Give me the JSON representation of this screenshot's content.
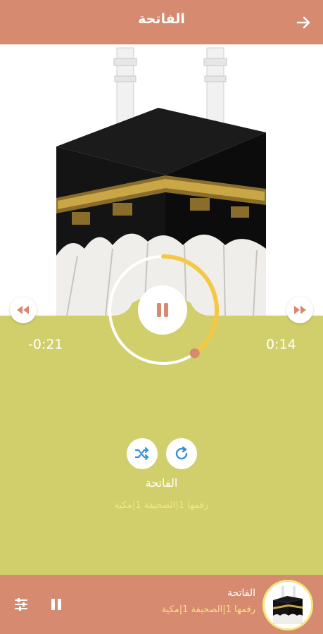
{
  "header": {
    "title": "الفاتحة",
    "back_icon": "arrow-right-icon"
  },
  "player": {
    "elapsed": "0:14",
    "remaining": "-0:21",
    "progress": 0.4,
    "rewind_icon": "fast-rewind-icon",
    "forward_icon": "fast-forward-icon",
    "pause_icon": "pause-icon",
    "shuffle_icon": "shuffle-icon",
    "repeat_icon": "repeat-icon"
  },
  "track": {
    "name": "الفاتحة",
    "info": "رقمها 1|الصحيفة 1|مكية"
  },
  "mini_player": {
    "title": "الفاتحة",
    "info": "رقمها 1|الصحيفة 1|مكية",
    "pause_icon": "pause-icon",
    "equalizer_icon": "equalizer-icon"
  },
  "colors": {
    "bar": "#d68a70",
    "panel": "#d1cf6c",
    "accent": "#f5c842",
    "knob": "#d68a70"
  }
}
